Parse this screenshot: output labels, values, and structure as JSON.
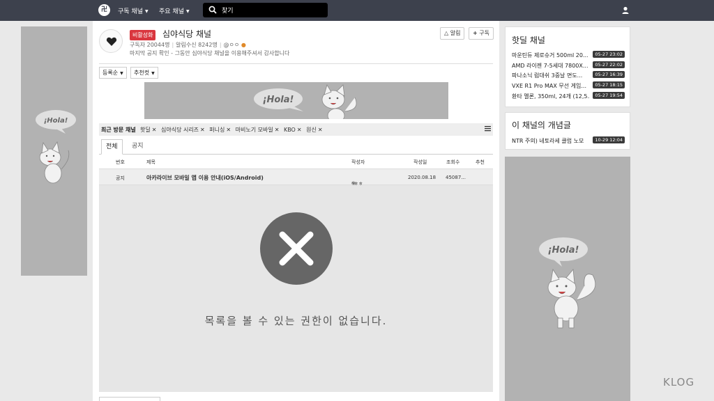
{
  "nav": {
    "logo": "卍",
    "menu_subscribed": "구독 채널",
    "menu_main": "주요 채널",
    "search_placeholder": "찾기"
  },
  "channel": {
    "badge": "비활성화",
    "title": "심야식당 채널",
    "subscribers": "구독자 20044명",
    "notify": "알림수신 8242명",
    "owner": "@ㅇㅇ",
    "notice": "마지막 공지 확인 - 그동안 심야식당 채널을 이용해주셔서 감사합니다",
    "btn_alarm": "알림",
    "btn_subscribe": "구독"
  },
  "controls": {
    "sort": "등록순",
    "recommend": "추천컷"
  },
  "banner": {
    "text": "¡Hola!"
  },
  "recent": {
    "label": "최근 방문 채널",
    "items": [
      "핫딜",
      "심야식당 시리즈",
      "퍼니싱",
      "마비노기 모바일",
      "KBO",
      "원신"
    ]
  },
  "tabs": {
    "all": "전체",
    "notice": "공지"
  },
  "table": {
    "headers": {
      "num": "번호",
      "title": "제목",
      "author": "작성자",
      "date": "작성일",
      "views": "조회수",
      "recommend": "추천"
    },
    "notice_row": {
      "num": "공지",
      "title": "아카라이브 모바일 앱 이용 안내(iOS/Android)",
      "author": "*ㅎㅎ",
      "date": "2020.08.18",
      "views": "45087..."
    }
  },
  "empty_message": "목록을 볼 수 있는 권한이 없습니다.",
  "hot_channel": {
    "title": "핫딜 채널",
    "items": [
      {
        "title": "마운틴듀 제로슈거 500ml 20...",
        "time": "05-27 23:02"
      },
      {
        "title": "AMD 라이젠 7-5세대 7800X...",
        "time": "05-27 22:02"
      },
      {
        "title": "파나소닉 럼대쉬 3중날 면도...",
        "time": "05-27 16:39"
      },
      {
        "title": "VXE R1 Pro MAX 무선 게임...",
        "time": "05-27 18:15"
      },
      {
        "title": "환타 멜론, 350ml, 24개 (12,5...",
        "time": "05-27 19:54"
      }
    ]
  },
  "concept": {
    "title": "이 채널의 개념글",
    "items": [
      {
        "title": "NTR 주의) 네토라세 클럽 노모",
        "time": "10-29 12:04"
      }
    ]
  },
  "ads": {
    "text": "¡Hola!"
  },
  "watermark": "KLOG"
}
